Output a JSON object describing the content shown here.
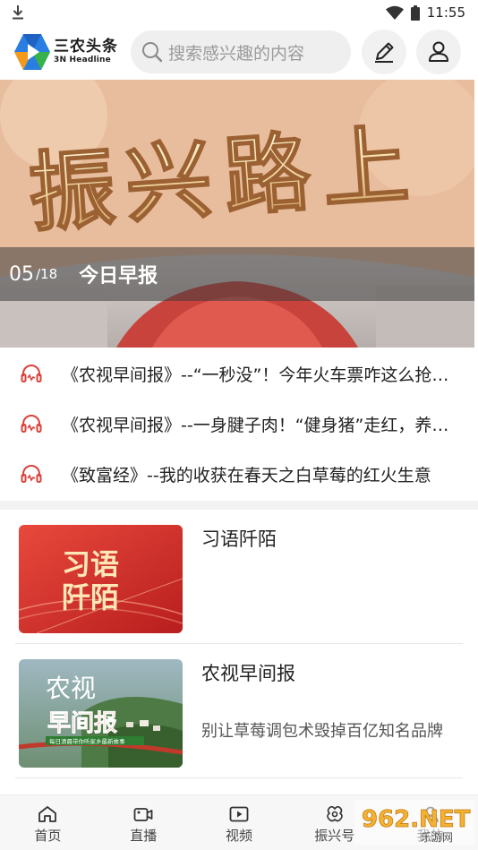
{
  "status_bar": {
    "time": "11:55",
    "icons": [
      "download-icon",
      "wifi-icon",
      "battery-icon"
    ]
  },
  "header": {
    "logo_cn": "三农头条",
    "logo_en": "3N Headline",
    "search_placeholder": "搜索感兴趣的内容",
    "icons": [
      "search-icon",
      "edit-icon",
      "user-icon"
    ]
  },
  "banner": {
    "art_text": "振兴路上",
    "date": "05",
    "date_total": "/18",
    "title": "今日早报"
  },
  "audio_items": [
    {
      "text": "《农视早间报》--“一秒没”！今年火车票咋这么抢手？"
    },
    {
      "text": "《农视早间报》--一身腱子肉！“健身猪”走红，养猪场里的"
    },
    {
      "text": "《致富经》--我的收获在春天之白草莓的红火生意"
    }
  ],
  "news": [
    {
      "title": "习语阡陌",
      "subtitle": "",
      "thumb_text": "习语阡陌"
    },
    {
      "title": "农视早间报",
      "subtitle": "别让草莓调包术毁掉百亿知名品牌",
      "thumb_text": "农视早间报",
      "thumb_caption": "每日清晨带你听家乡最新故事"
    }
  ],
  "bottom_nav": [
    {
      "label": "首页",
      "icon": "home-icon"
    },
    {
      "label": "直播",
      "icon": "live-icon"
    },
    {
      "label": "视频",
      "icon": "video-icon"
    },
    {
      "label": "振兴号",
      "icon": "revitalize-icon"
    },
    {
      "label": "我的",
      "icon": "profile-icon"
    }
  ],
  "watermark": {
    "text": "962.NET",
    "sub": "乐游网"
  },
  "colors": {
    "accent_red": "#d9433c",
    "search_bg": "#efefef",
    "logo_blue": "#2a7de1",
    "logo_orange": "#f39a1b",
    "logo_green": "#36b24a"
  }
}
